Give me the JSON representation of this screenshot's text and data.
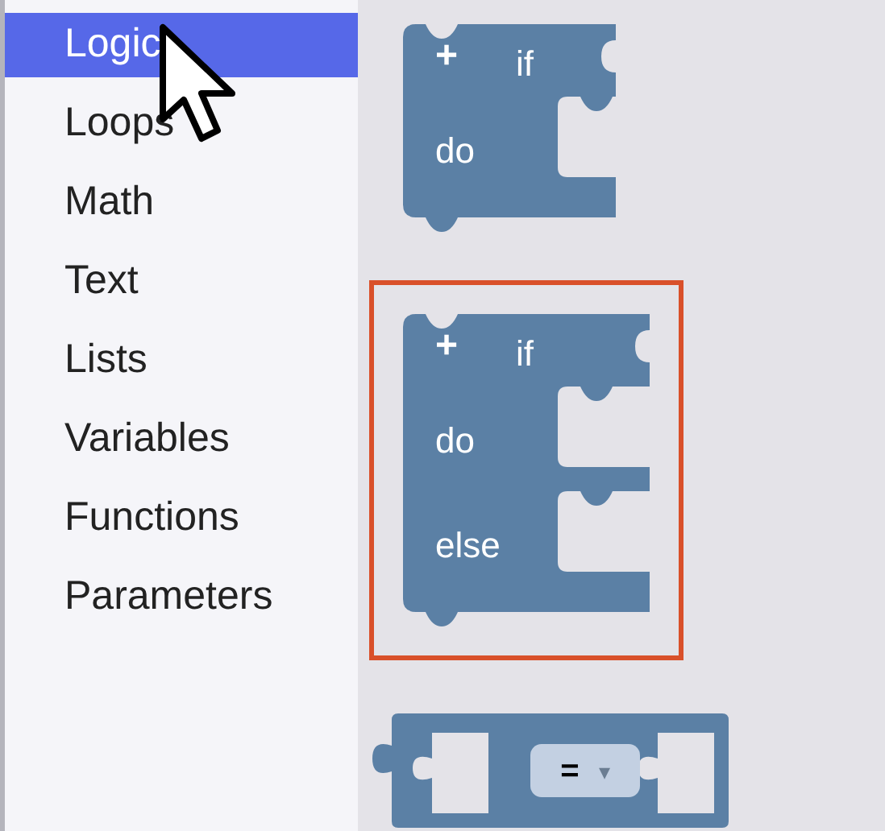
{
  "toolbox": {
    "categories": [
      {
        "label": "Logic",
        "selected": true
      },
      {
        "label": "Loops",
        "selected": false
      },
      {
        "label": "Math",
        "selected": false
      },
      {
        "label": "Text",
        "selected": false
      },
      {
        "label": "Lists",
        "selected": false
      },
      {
        "label": "Variables",
        "selected": false
      },
      {
        "label": "Functions",
        "selected": false
      },
      {
        "label": "Parameters",
        "selected": false
      }
    ]
  },
  "blocks": [
    {
      "kind": "if",
      "plus": "+",
      "rows": [
        "if",
        "do"
      ],
      "highlighted": false
    },
    {
      "kind": "if",
      "plus": "+",
      "rows": [
        "if",
        "do",
        "else"
      ],
      "highlighted": true
    },
    {
      "kind": "compare",
      "operator": "=",
      "dropdown": "▾",
      "highlighted": false
    }
  ]
}
